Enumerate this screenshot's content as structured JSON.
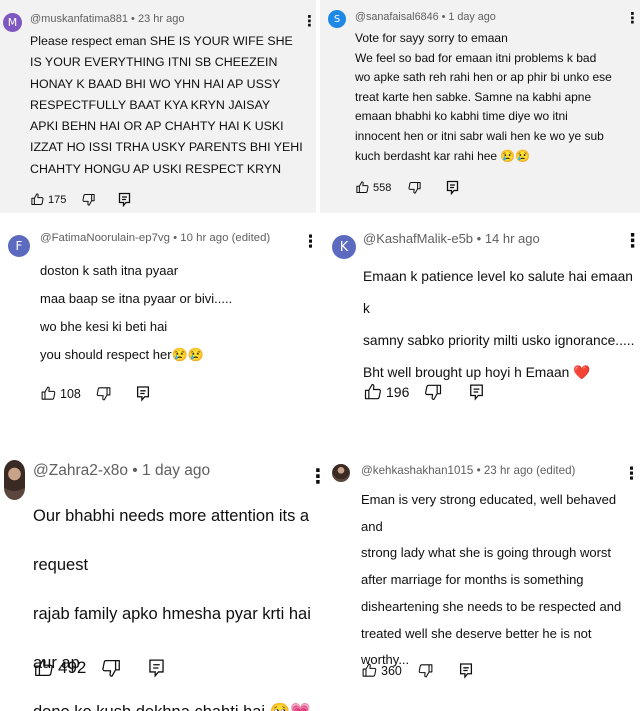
{
  "comments": [
    {
      "avatar_letter": "M",
      "avatar_color": "#7e57c2",
      "handle": "@muskanfatima881",
      "separator": " • ",
      "time": "23 hr ago",
      "lines": [
        "Please respect eman SHE IS YOUR WIFE SHE",
        "IS YOUR EVERYTHING ITNI SB CHEEZEIN",
        "HONAY K BAAD BHI WO YHN HAI AP USSY",
        "RESPECTFULLY BAAT KYA KRYN JAISAY",
        "APKI BEHN HAI OR AP CHAHTY HAI K USKI",
        "IZZAT HO ISSI TRHA USKY PARENTS BHI YEHI",
        "CHAHTY HONGU AP USKI RESPECT KRYN"
      ],
      "likes": "175"
    },
    {
      "avatar_letter": "S",
      "avatar_color": "#1e88e5",
      "handle": "@sanafaisal6846",
      "separator": " • ",
      "time": "1 day ago",
      "lines": [
        "Vote for sayy sorry to emaan",
        "We feel so bad for emaan itni problems k bad",
        "wo apke sath reh rahi hen or ap phir bi unko ese",
        "treat karte hen sabke. Samne na kabhi apne",
        "emaan bhabhi ko kabhi time diye wo itni",
        "innocent hen or itni sabr wali hen ke wo ye sub",
        "kuch berdasht kar rahi hee 😢😢"
      ],
      "likes": "558"
    },
    {
      "avatar_letter": "F",
      "avatar_color": "#5c6bc0",
      "handle": "@FatimaNoorulain-ep7vg",
      "separator": " • ",
      "time": "10 hr ago (edited)",
      "lines": [
        "doston k sath itna pyaar",
        "maa baap se itna pyaar or bivi.....",
        "wo bhe kesi ki beti hai",
        "you should respect her😢😢"
      ],
      "likes": "108"
    },
    {
      "avatar_letter": "K",
      "avatar_color": "#5c6bc0",
      "handle": "@KashafMalik-e5b",
      "separator": " • ",
      "time": "14 hr ago",
      "lines": [
        "Emaan k patience level ko salute hai emaan k",
        "samny sabko priority milti usko ignorance.....",
        "Bht well brought up hoyi h Emaan ❤️"
      ],
      "likes": "196"
    },
    {
      "avatar_letter": "",
      "avatar_color": "#3a2a24",
      "handle": "@Zahra2-x8o",
      "separator": " • ",
      "time": "1 day ago",
      "lines": [
        "Our bhabhi needs more attention its a request",
        "rajab family apko hmesha pyar krti hai aur ap",
        "dono ko kush dekhna chahti hai 🥺💗"
      ],
      "likes": "492"
    },
    {
      "avatar_letter": "",
      "avatar_color": "#3a2a24",
      "handle": "@kehkashakhan1015",
      "separator": " • ",
      "time": "23 hr ago (edited)",
      "lines": [
        "Eman is very strong educated, well behaved and",
        "strong lady what she is going through worst",
        "after marriage for months is something",
        "disheartening she needs to be respected and",
        "treated well she deserve better he is not",
        "worthy..."
      ],
      "likes": "360"
    }
  ],
  "icons": {
    "like": "thumbs-up-icon",
    "dislike": "thumbs-down-icon",
    "reply": "reply-icon",
    "more": "more-vert-icon"
  },
  "more_glyph": "⋮"
}
